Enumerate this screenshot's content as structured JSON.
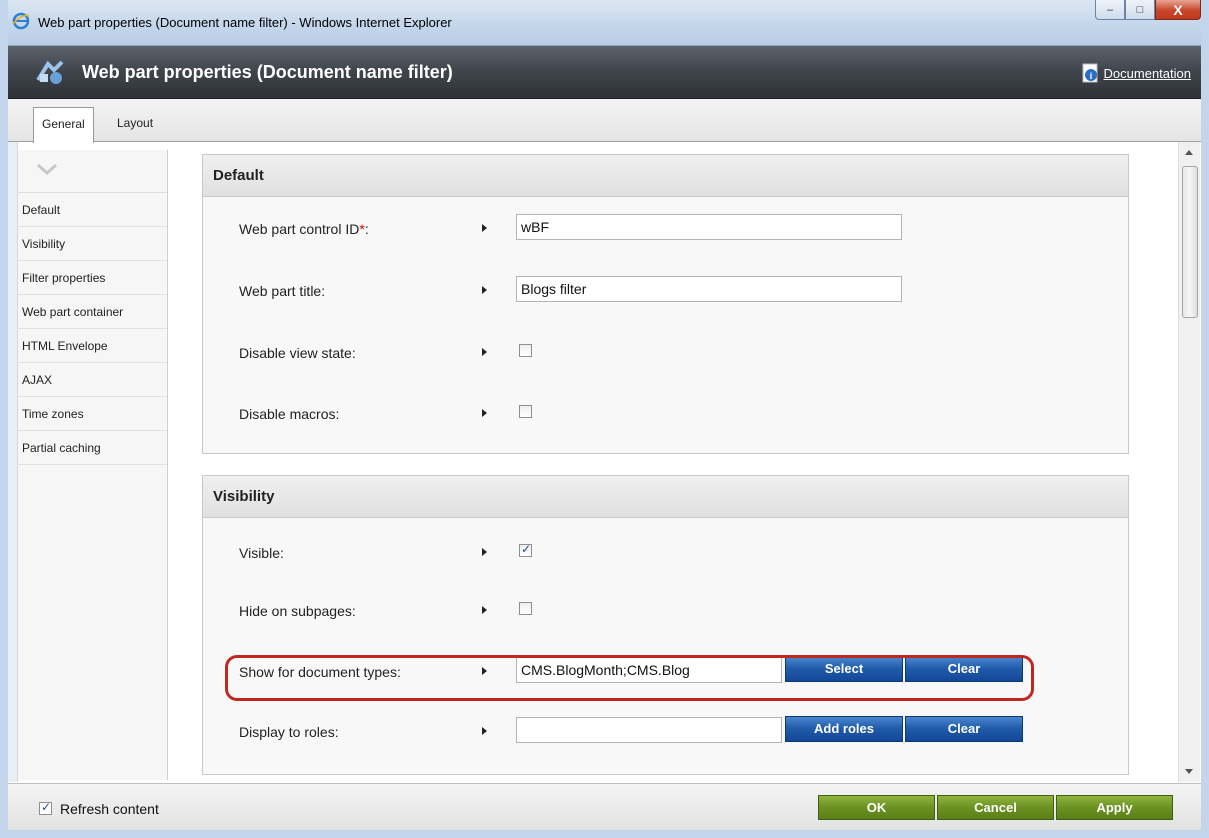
{
  "window": {
    "title": "Web part properties (Document name filter) - Windows Internet Explorer",
    "minimize": "–",
    "maximize": "□",
    "close": "X"
  },
  "dialog": {
    "title": "Web part properties (Document name filter)",
    "documentation": "Documentation"
  },
  "tabs": [
    {
      "label": "General",
      "active": true
    },
    {
      "label": "Layout",
      "active": false
    }
  ],
  "left_menu": {
    "items": [
      "Default",
      "Visibility",
      "Filter properties",
      "Web part container",
      "HTML Envelope",
      "AJAX",
      "Time zones",
      "Partial caching"
    ]
  },
  "default_section": {
    "title": "Default",
    "control_id_label": "Web part control ID",
    "control_id_required": "*",
    "control_id_colon": ":",
    "control_id_value": "wBF",
    "title_label": "Web part title:",
    "title_value": "Blogs filter",
    "disable_view_state_label": "Disable view state:",
    "disable_view_state_checked": false,
    "disable_macros_label": "Disable macros:",
    "disable_macros_checked": false
  },
  "visibility_section": {
    "title": "Visibility",
    "visible_label": "Visible:",
    "visible_checked": true,
    "hide_subpages_label": "Hide on subpages:",
    "hide_subpages_checked": false,
    "doc_types_label": "Show for document types:",
    "doc_types_value": "CMS.BlogMonth;CMS.Blog",
    "select_button": "Select",
    "clear_button": "Clear",
    "roles_label": "Display to roles:",
    "roles_value": "",
    "add_roles_button": "Add roles",
    "roles_clear_button": "Clear"
  },
  "footer": {
    "refresh_label": "Refresh content",
    "refresh_checked": true,
    "ok": "OK",
    "cancel": "Cancel",
    "apply": "Apply"
  },
  "colors": {
    "header_bg": "#3f444b",
    "blue_button": "#1f5aa8",
    "green_button": "#6b9122",
    "highlight": "#c0281e"
  },
  "icons": [
    "ie-icon",
    "webpart-icon",
    "info-icon",
    "chevron-down-icon",
    "arrow-right-icon"
  ]
}
